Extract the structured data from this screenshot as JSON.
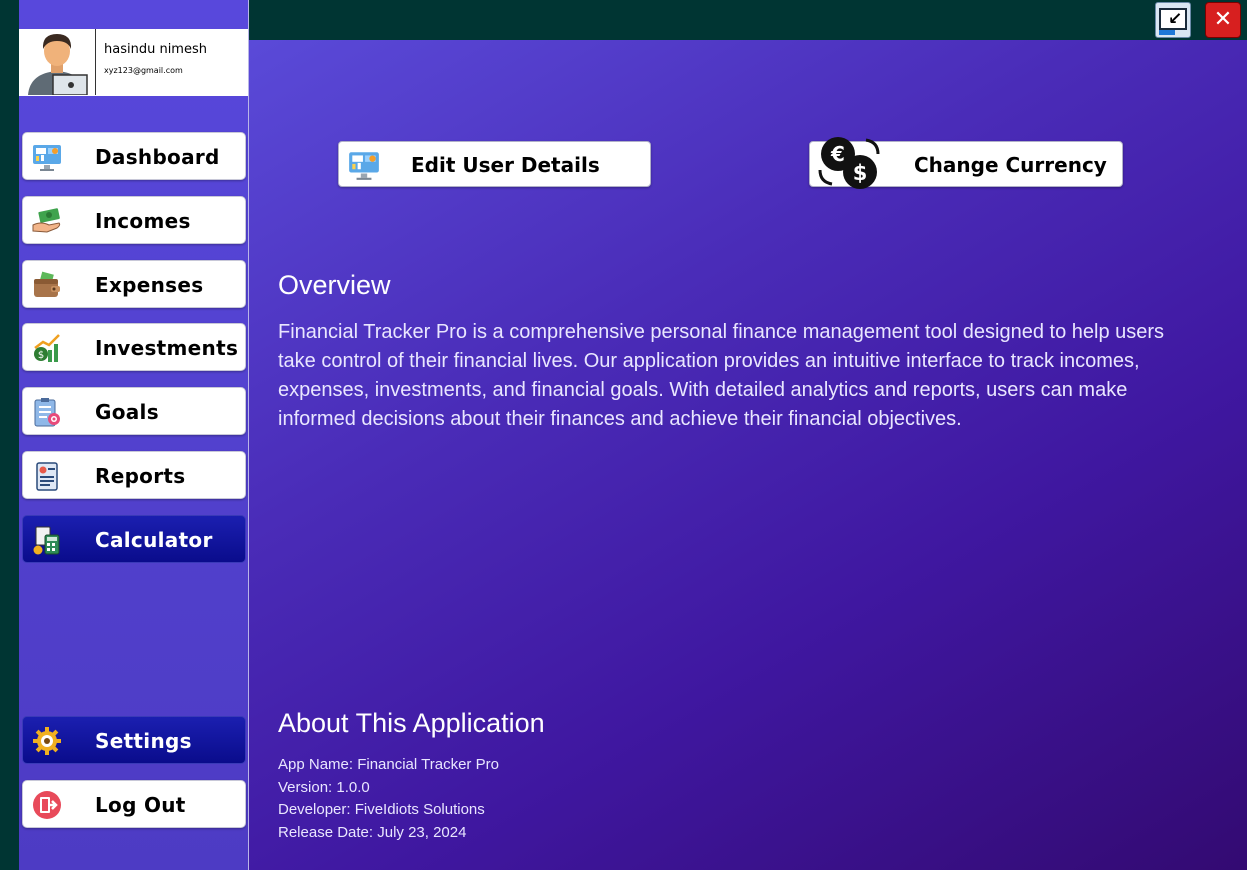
{
  "user": {
    "name": "hasindu nimesh",
    "email": "xyz123@gmail.com"
  },
  "sidebar": {
    "items": [
      {
        "label": "Dashboard",
        "icon": "dashboard-icon",
        "active": false
      },
      {
        "label": "Incomes",
        "icon": "money-hand-icon",
        "active": false
      },
      {
        "label": "Expenses",
        "icon": "wallet-icon",
        "active": false
      },
      {
        "label": "Investments",
        "icon": "investment-growth-icon",
        "active": false
      },
      {
        "label": "Goals",
        "icon": "goal-checklist-icon",
        "active": false
      },
      {
        "label": "Reports",
        "icon": "report-icon",
        "active": false
      },
      {
        "label": "Calculator",
        "icon": "calculator-icon",
        "active": true
      }
    ],
    "settings_label": "Settings",
    "logout_label": "Log Out"
  },
  "actions": {
    "edit_user_label": "Edit User Details",
    "change_currency_label": "Change Currency"
  },
  "overview": {
    "heading": "Overview",
    "text": "Financial Tracker Pro is a comprehensive personal finance management tool designed to help users take control of their financial lives. Our application provides an intuitive interface to track incomes, expenses, investments, and financial goals. With detailed analytics and reports, users can make informed decisions about their finances and achieve their financial objectives."
  },
  "about": {
    "heading": "About This Application",
    "app_name": "App Name: Financial Tracker Pro",
    "version": "Version: 1.0.0",
    "developer": "Developer: FiveIdiots Solutions",
    "release_date": "Release Date: July 23, 2024"
  },
  "colors": {
    "accent_dark_button": "#0a0c8c",
    "main_gradient_start": "#5a4ad8",
    "main_gradient_end": "#330a72",
    "sidebar_bg": "#5343d2",
    "frame_bg": "#003533",
    "close_button": "#d71f1f"
  }
}
